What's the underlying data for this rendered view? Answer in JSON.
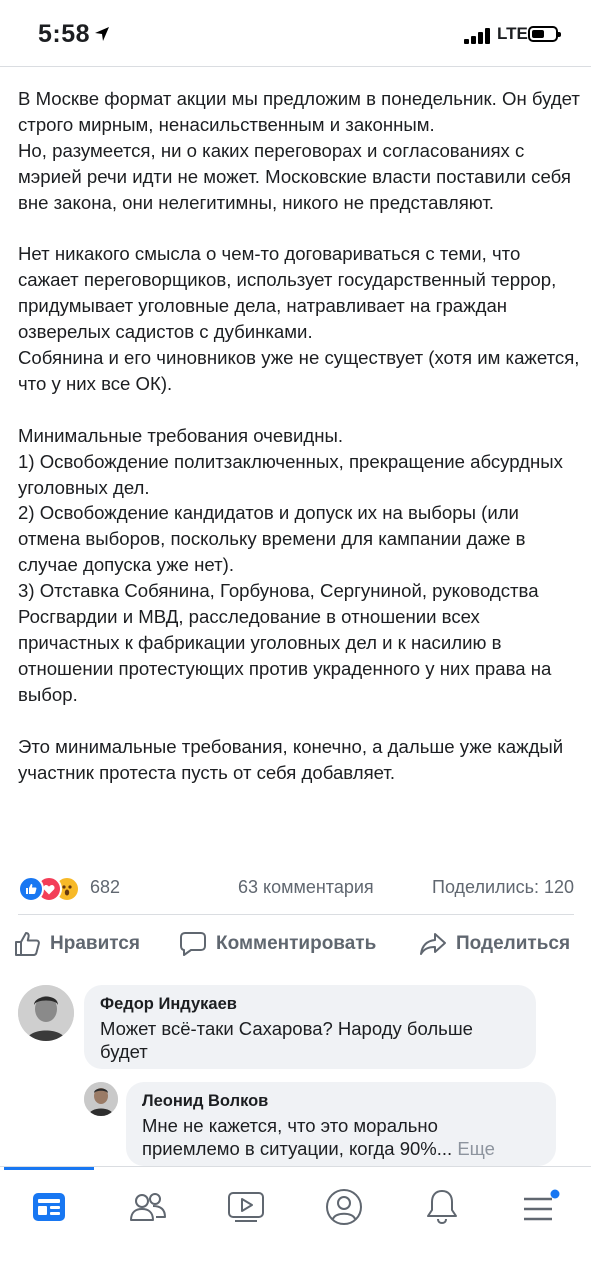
{
  "status_bar": {
    "time": "5:58",
    "network": "LTE"
  },
  "post": {
    "paragraphs": [
      "В Москве формат акции мы предложим в понедельник. Он будет строго мирным, ненасильственным и законным.\nНо, разумеется, ни о каких переговорах и согласованиях с мэрией речи идти не может. Московские власти поставили себя вне закона, они нелегитимны, никого не представляют.",
      "Нет никакого смысла о чем-то договариваться с теми, что сажает переговорщиков, использует государственный террор, придумывает уголовные дела, натравливает на граждан озверелых садистов с дубинками.\nСобянина и его чиновников уже не существует (хотя им кажется, что у них все ОК).",
      "Минимальные требования очевидны.\n1) Освобождение политзаключенных, прекращение абсурдных уголовных дел.\n2) Освобождение кандидатов и допуск их на выборы (или отмена выборов, поскольку времени для кампании даже в случае допуска уже нет).\n3) Отставка Собянина, Горбунова, Сергуниной, руководства Росгвардии и МВД, расследование в отношении всех причастных к фабрикации уголовных дел и к насилию в отношении протестующих против украденного у них права на выбор.",
      "Это минимальные требования, конечно, а дальше уже каждый участник протеста пусть от себя добавляет."
    ],
    "reaction_count": "682",
    "comments_count": "63 комментария",
    "shares_count": "Поделились: 120"
  },
  "actions": {
    "like": "Нравится",
    "comment": "Комментировать",
    "share": "Поделиться"
  },
  "comments": [
    {
      "author": "Федор Индукаев",
      "text": "Может всё-таки Сахарова? Народу больше будет"
    },
    {
      "author": "Леонид Волков",
      "text": "Мне не кажется, что это морально приемлемо в ситуации, когда 90%...",
      "more": "Еще"
    }
  ],
  "tabs": [
    "news-feed-icon",
    "friends-icon",
    "watch-icon",
    "profile-icon",
    "notifications-icon",
    "menu-icon"
  ],
  "colors": {
    "accent": "#1877f2",
    "bubble": "#f0f2f5",
    "secondary_text": "#606770"
  }
}
